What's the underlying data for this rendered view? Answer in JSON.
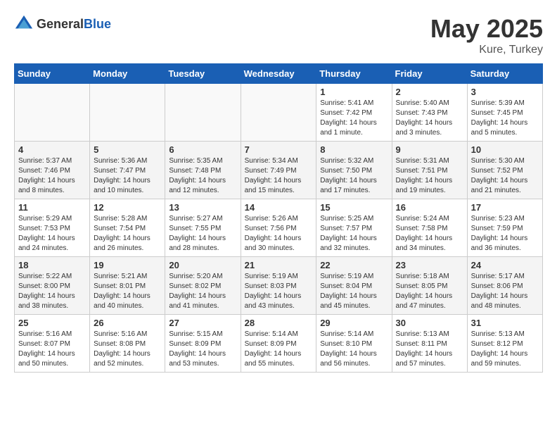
{
  "header": {
    "logo_general": "General",
    "logo_blue": "Blue",
    "title": "May 2025",
    "location": "Kure, Turkey"
  },
  "weekdays": [
    "Sunday",
    "Monday",
    "Tuesday",
    "Wednesday",
    "Thursday",
    "Friday",
    "Saturday"
  ],
  "weeks": [
    [
      {
        "day": "",
        "info": ""
      },
      {
        "day": "",
        "info": ""
      },
      {
        "day": "",
        "info": ""
      },
      {
        "day": "",
        "info": ""
      },
      {
        "day": "1",
        "info": "Sunrise: 5:41 AM\nSunset: 7:42 PM\nDaylight: 14 hours\nand 1 minute."
      },
      {
        "day": "2",
        "info": "Sunrise: 5:40 AM\nSunset: 7:43 PM\nDaylight: 14 hours\nand 3 minutes."
      },
      {
        "day": "3",
        "info": "Sunrise: 5:39 AM\nSunset: 7:45 PM\nDaylight: 14 hours\nand 5 minutes."
      }
    ],
    [
      {
        "day": "4",
        "info": "Sunrise: 5:37 AM\nSunset: 7:46 PM\nDaylight: 14 hours\nand 8 minutes."
      },
      {
        "day": "5",
        "info": "Sunrise: 5:36 AM\nSunset: 7:47 PM\nDaylight: 14 hours\nand 10 minutes."
      },
      {
        "day": "6",
        "info": "Sunrise: 5:35 AM\nSunset: 7:48 PM\nDaylight: 14 hours\nand 12 minutes."
      },
      {
        "day": "7",
        "info": "Sunrise: 5:34 AM\nSunset: 7:49 PM\nDaylight: 14 hours\nand 15 minutes."
      },
      {
        "day": "8",
        "info": "Sunrise: 5:32 AM\nSunset: 7:50 PM\nDaylight: 14 hours\nand 17 minutes."
      },
      {
        "day": "9",
        "info": "Sunrise: 5:31 AM\nSunset: 7:51 PM\nDaylight: 14 hours\nand 19 minutes."
      },
      {
        "day": "10",
        "info": "Sunrise: 5:30 AM\nSunset: 7:52 PM\nDaylight: 14 hours\nand 21 minutes."
      }
    ],
    [
      {
        "day": "11",
        "info": "Sunrise: 5:29 AM\nSunset: 7:53 PM\nDaylight: 14 hours\nand 24 minutes."
      },
      {
        "day": "12",
        "info": "Sunrise: 5:28 AM\nSunset: 7:54 PM\nDaylight: 14 hours\nand 26 minutes."
      },
      {
        "day": "13",
        "info": "Sunrise: 5:27 AM\nSunset: 7:55 PM\nDaylight: 14 hours\nand 28 minutes."
      },
      {
        "day": "14",
        "info": "Sunrise: 5:26 AM\nSunset: 7:56 PM\nDaylight: 14 hours\nand 30 minutes."
      },
      {
        "day": "15",
        "info": "Sunrise: 5:25 AM\nSunset: 7:57 PM\nDaylight: 14 hours\nand 32 minutes."
      },
      {
        "day": "16",
        "info": "Sunrise: 5:24 AM\nSunset: 7:58 PM\nDaylight: 14 hours\nand 34 minutes."
      },
      {
        "day": "17",
        "info": "Sunrise: 5:23 AM\nSunset: 7:59 PM\nDaylight: 14 hours\nand 36 minutes."
      }
    ],
    [
      {
        "day": "18",
        "info": "Sunrise: 5:22 AM\nSunset: 8:00 PM\nDaylight: 14 hours\nand 38 minutes."
      },
      {
        "day": "19",
        "info": "Sunrise: 5:21 AM\nSunset: 8:01 PM\nDaylight: 14 hours\nand 40 minutes."
      },
      {
        "day": "20",
        "info": "Sunrise: 5:20 AM\nSunset: 8:02 PM\nDaylight: 14 hours\nand 41 minutes."
      },
      {
        "day": "21",
        "info": "Sunrise: 5:19 AM\nSunset: 8:03 PM\nDaylight: 14 hours\nand 43 minutes."
      },
      {
        "day": "22",
        "info": "Sunrise: 5:19 AM\nSunset: 8:04 PM\nDaylight: 14 hours\nand 45 minutes."
      },
      {
        "day": "23",
        "info": "Sunrise: 5:18 AM\nSunset: 8:05 PM\nDaylight: 14 hours\nand 47 minutes."
      },
      {
        "day": "24",
        "info": "Sunrise: 5:17 AM\nSunset: 8:06 PM\nDaylight: 14 hours\nand 48 minutes."
      }
    ],
    [
      {
        "day": "25",
        "info": "Sunrise: 5:16 AM\nSunset: 8:07 PM\nDaylight: 14 hours\nand 50 minutes."
      },
      {
        "day": "26",
        "info": "Sunrise: 5:16 AM\nSunset: 8:08 PM\nDaylight: 14 hours\nand 52 minutes."
      },
      {
        "day": "27",
        "info": "Sunrise: 5:15 AM\nSunset: 8:09 PM\nDaylight: 14 hours\nand 53 minutes."
      },
      {
        "day": "28",
        "info": "Sunrise: 5:14 AM\nSunset: 8:09 PM\nDaylight: 14 hours\nand 55 minutes."
      },
      {
        "day": "29",
        "info": "Sunrise: 5:14 AM\nSunset: 8:10 PM\nDaylight: 14 hours\nand 56 minutes."
      },
      {
        "day": "30",
        "info": "Sunrise: 5:13 AM\nSunset: 8:11 PM\nDaylight: 14 hours\nand 57 minutes."
      },
      {
        "day": "31",
        "info": "Sunrise: 5:13 AM\nSunset: 8:12 PM\nDaylight: 14 hours\nand 59 minutes."
      }
    ]
  ]
}
